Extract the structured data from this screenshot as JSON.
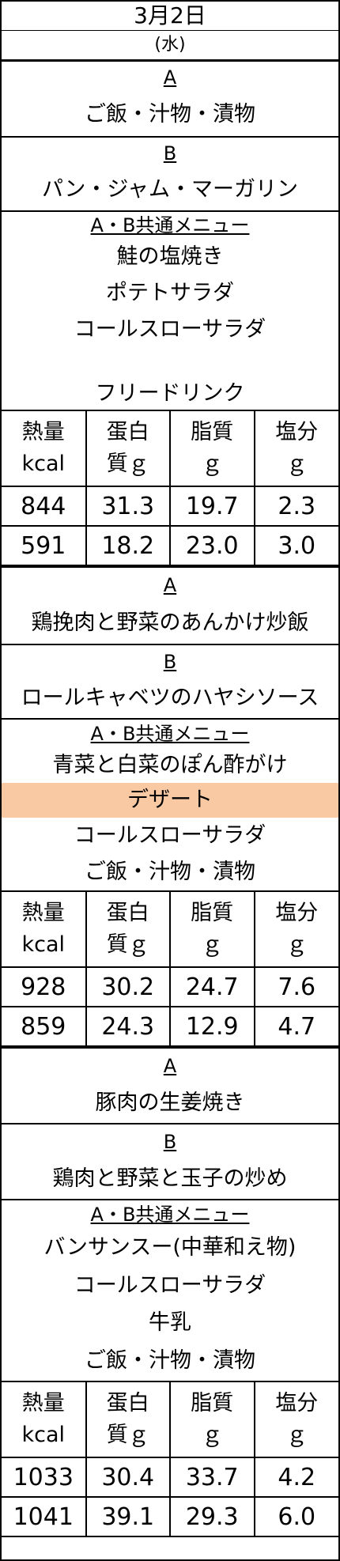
{
  "header": {
    "date": "3月2日",
    "weekday": "(水)"
  },
  "nutrition_headers": [
    [
      "熱量",
      "kcal"
    ],
    [
      "蛋白",
      "質ｇ"
    ],
    [
      "脂質",
      "ｇ"
    ],
    [
      "塩分",
      "ｇ"
    ]
  ],
  "meals": [
    {
      "a_label": "A",
      "a_items": [
        "ご飯・汁物・漬物"
      ],
      "b_label": "B",
      "b_items": [
        "パン・ジャム・マーガリン"
      ],
      "common_label": "A・B共通メニュー",
      "common_items": [
        "鮭の塩焼き",
        "ポテトサラダ",
        "コールスローサラダ",
        "",
        "フリードリンク"
      ],
      "nutrition": [
        [
          "844",
          "31.3",
          "19.7",
          "2.3"
        ],
        [
          "591",
          "18.2",
          "23.0",
          "3.0"
        ]
      ]
    },
    {
      "a_label": "A",
      "a_items": [
        "鶏挽肉と野菜のあんかけ炒飯"
      ],
      "b_label": "B",
      "b_items": [
        "ロールキャベツのハヤシソース"
      ],
      "common_label": "A・B共通メニュー",
      "common_items": [
        "青菜と白菜のぽん酢がけ",
        "デザート",
        "コールスローサラダ",
        "ご飯・汁物・漬物"
      ],
      "highlight_color": "#f9c9a3",
      "nutrition": [
        [
          "928",
          "30.2",
          "24.7",
          "7.6"
        ],
        [
          "859",
          "24.3",
          "12.9",
          "4.7"
        ]
      ]
    },
    {
      "a_label": "A",
      "a_items": [
        "豚肉の生姜焼き"
      ],
      "b_label": "B",
      "b_items": [
        "鶏肉と野菜と玉子の炒め"
      ],
      "common_label": "A・B共通メニュー",
      "common_items": [
        "バンサンスー(中華和え物)",
        "コールスローサラダ",
        "牛乳",
        "ご飯・汁物・漬物"
      ],
      "nutrition": [
        [
          "1033",
          "30.4",
          "33.7",
          "4.2"
        ],
        [
          "1041",
          "39.1",
          "29.3",
          "6.0"
        ]
      ]
    }
  ]
}
